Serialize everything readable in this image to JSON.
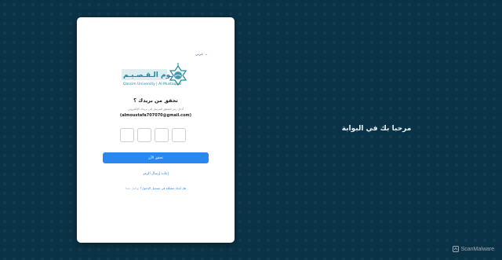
{
  "login_card": {
    "language_switch": "عربي",
    "logo_text": "Qassim University | Al-Mustaqbal",
    "title": "تحقق من بريدك ؟",
    "description": "أدخل رمز التحقق المرسل إلى بريدك الإلكتروني",
    "email": "(almoustafa707070@gmail.com)",
    "verify_button": "تحقق الآن",
    "resend_link": "إعادة إرسال الرمز",
    "footer_text": "هل لديك مشكلة في تسجيل الدخول؟",
    "footer_link": "تواصل معنا"
  },
  "side_panel": {
    "text": "مرحبا بك في البوابة"
  },
  "watermark": {
    "text": "ScanMalware"
  },
  "colors": {
    "background": "#0b3347",
    "accent": "#2a87f0",
    "link": "#2a7de1",
    "logo_teal": "#1e8a9c"
  }
}
